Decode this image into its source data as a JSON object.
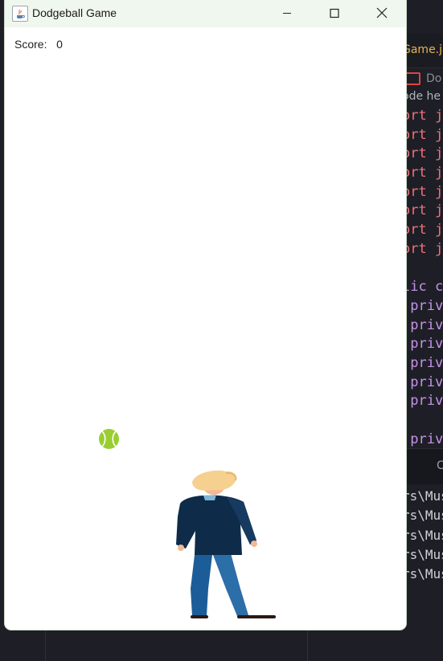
{
  "ide": {
    "tab_file": "Game.ja",
    "breadcrumb": "Do",
    "hint": "ode he",
    "code_lines": [
      {
        "text": "ort j",
        "kind": "import"
      },
      {
        "text": "ort j",
        "kind": "import"
      },
      {
        "text": "ort j",
        "kind": "import"
      },
      {
        "text": "ort j",
        "kind": "import"
      },
      {
        "text": "ort j",
        "kind": "import"
      },
      {
        "text": "ort j",
        "kind": "import"
      },
      {
        "text": "ort j",
        "kind": "import"
      },
      {
        "text": "ort j",
        "kind": "import"
      },
      {
        "text": "",
        "kind": "blank"
      },
      {
        "text": "lic c",
        "kind": "mod"
      },
      {
        "text": " priv",
        "kind": "mod"
      },
      {
        "text": " priv",
        "kind": "mod"
      },
      {
        "text": " priv",
        "kind": "mod"
      },
      {
        "text": " priv",
        "kind": "mod"
      },
      {
        "text": " priv",
        "kind": "mod"
      },
      {
        "text": " priv",
        "kind": "mod"
      },
      {
        "text": "",
        "kind": "blank"
      },
      {
        "text": " priv",
        "kind": "mod"
      }
    ],
    "terminal_tab": "C",
    "terminal_lines": [
      "rs\\Mus",
      "rs\\Mus",
      "rs\\Mus",
      "rs\\Mus",
      "rs\\Mus"
    ]
  },
  "window": {
    "title": "Dodgeball Game",
    "app_icon": "java-icon",
    "controls": [
      "minimize-icon",
      "maximize-icon",
      "close-icon"
    ]
  },
  "game": {
    "score_label": "Score:",
    "score_value": "0",
    "ball_color": "#9acd32",
    "player_colors": {
      "jacket": "#0e2b49",
      "pants": "#1c5d99",
      "hair": "#f6d08f",
      "skin": "#f2b894"
    }
  },
  "colors": {
    "titlebar_bg": "#f0f7ee",
    "ide_bg": "#1e1f26",
    "import_keyword": "#f07178",
    "modifier_keyword": "#c792ea",
    "file_tab": "#e6b450"
  }
}
